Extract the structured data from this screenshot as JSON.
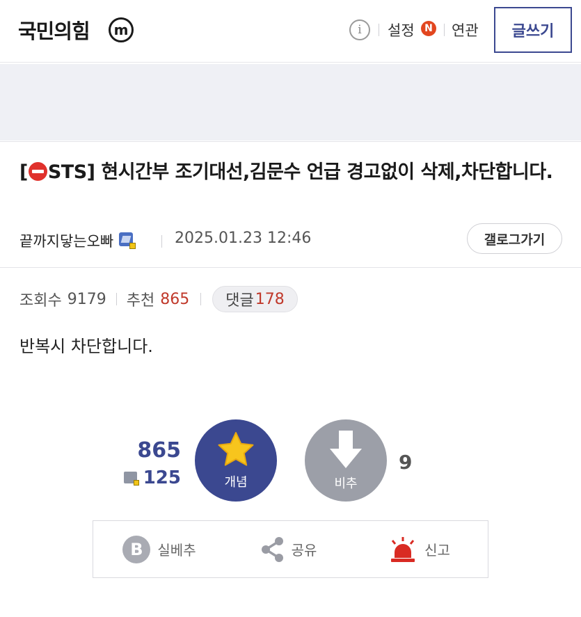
{
  "header": {
    "gallery_title": "국민의힘",
    "minor_badge": "m",
    "info_icon": "info-icon",
    "settings_label": "설정",
    "new_badge": "N",
    "related_label": "연관",
    "write_button": "글쓰기"
  },
  "post": {
    "title_prefix_open": "[",
    "title_prefix_tag": "STS]",
    "title_text": " 현시간부 조기대선,김문수 언급 경고없이 삭제,차단합니다.",
    "author": "끝까지닿는오빠",
    "date": "2025.01.23 12:46",
    "gallery_link": "갤로그가기",
    "views_label": "조회수",
    "views": "9179",
    "recommend_label": "추천",
    "recommend": "865",
    "comments_label": "댓글",
    "comments": "178",
    "body": "반복시 차단합니다."
  },
  "vote": {
    "recommend_count": "865",
    "fixed_count": "125",
    "upvote_label": "개념",
    "downvote_label": "비추",
    "downvote_count": "9"
  },
  "actions": {
    "silbe_label": "실베추",
    "silbe_icon_text": "B",
    "share_label": "공유",
    "report_label": "신고"
  },
  "colors": {
    "brand": "#3b4890",
    "accent_red": "#c0392b",
    "downvote_gray": "#9c9fa8",
    "star": "#f7c51d"
  }
}
